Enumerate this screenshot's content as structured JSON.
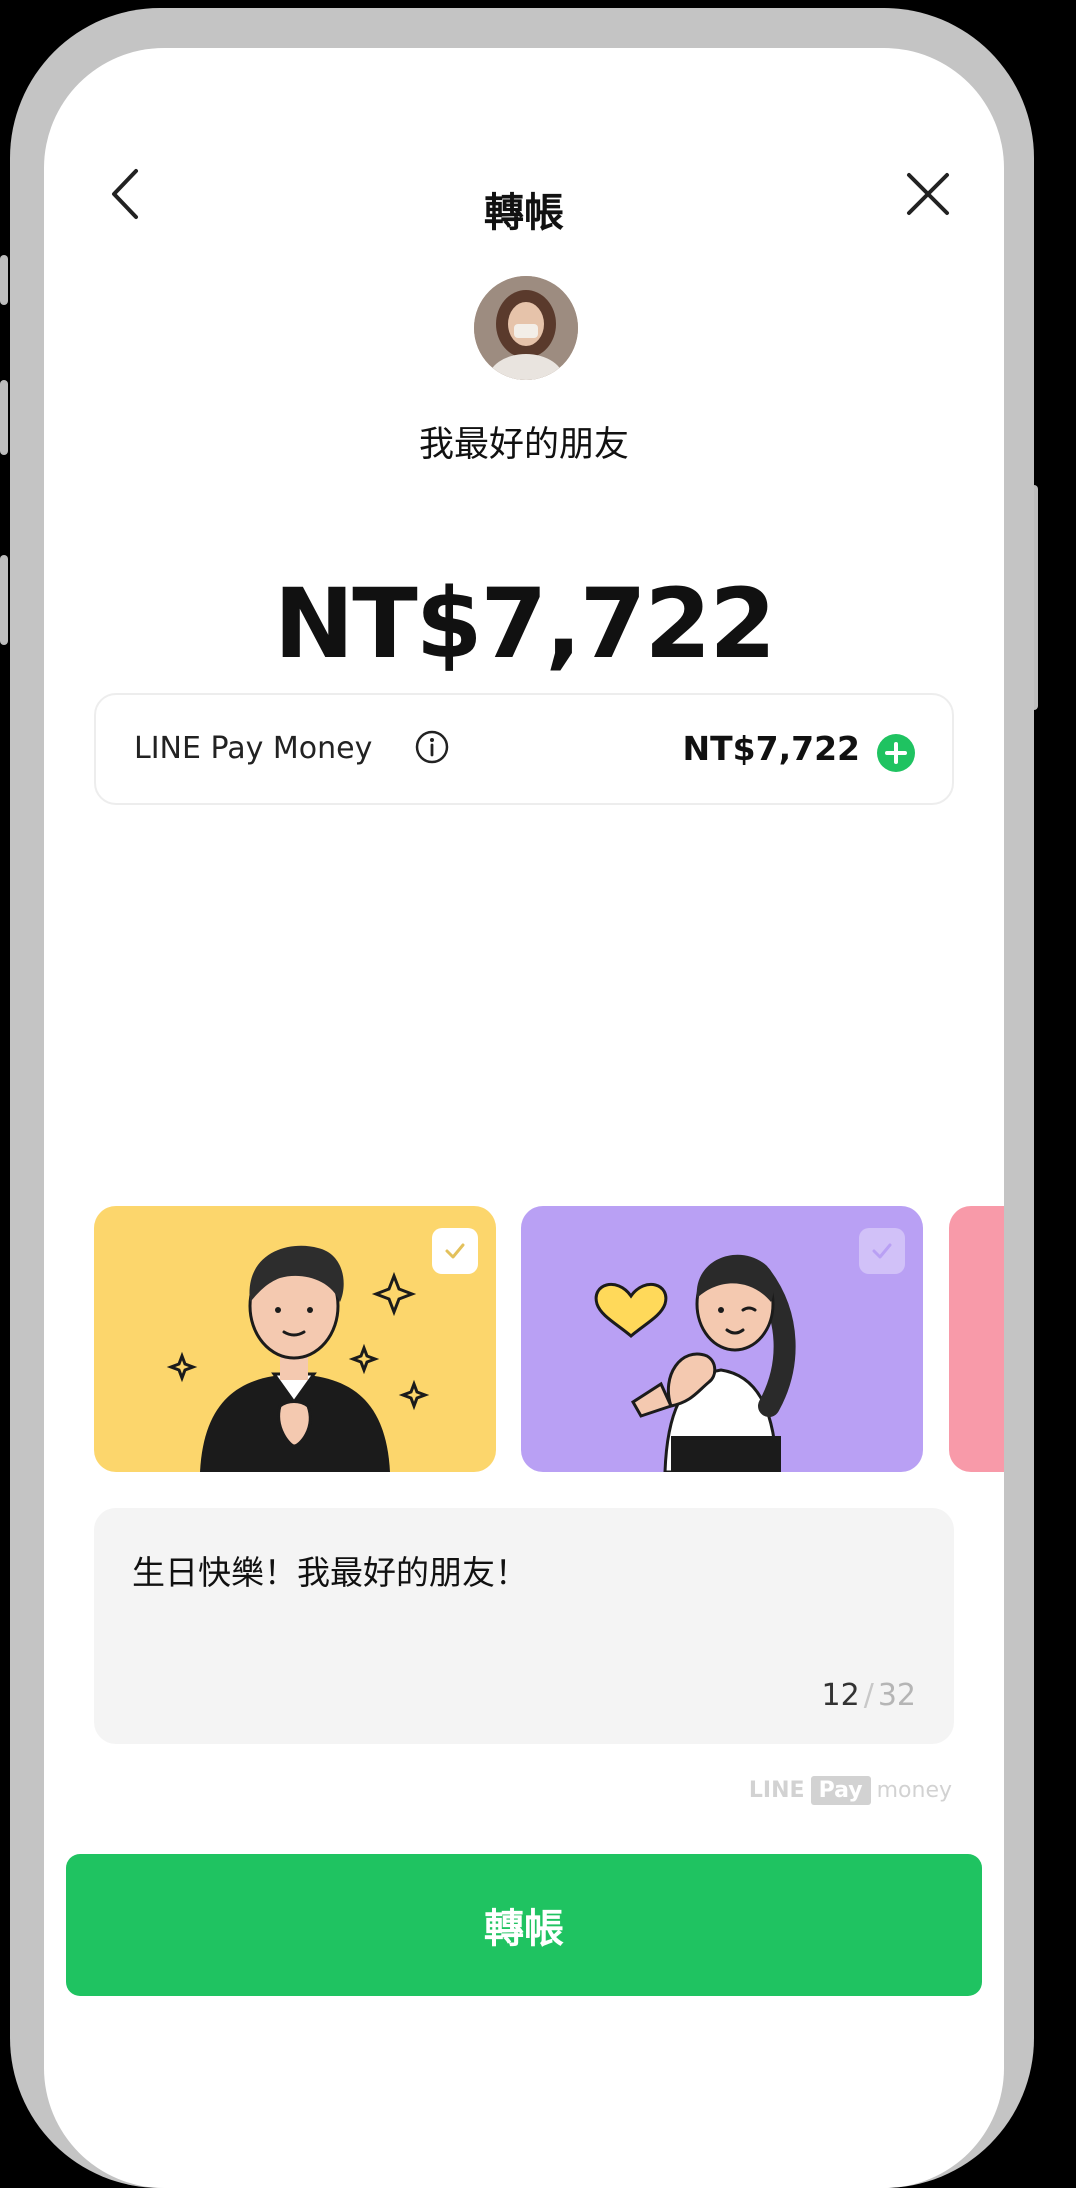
{
  "header": {
    "title": "轉帳"
  },
  "recipient": {
    "name": "我最好的朋友"
  },
  "amount": "NT$7,722",
  "balance": {
    "label": "LINE Pay Money",
    "value": "NT$7,722"
  },
  "cards": [
    {
      "theme": "yellow",
      "selected": true
    },
    {
      "theme": "purple",
      "selected": false
    },
    {
      "theme": "pink",
      "selected": false
    }
  ],
  "message": {
    "text": "生日快樂！我最好的朋友！",
    "count": "12",
    "separator": "/",
    "max": "32"
  },
  "brand": {
    "line": "LINE",
    "pay": "Pay",
    "money": "money"
  },
  "primary_button": {
    "label": "轉帳"
  },
  "colors": {
    "accent": "#1fc361",
    "card_yellow": "#fcd66c",
    "card_purple": "#b9a0f4",
    "card_pink": "#f89aa9"
  }
}
